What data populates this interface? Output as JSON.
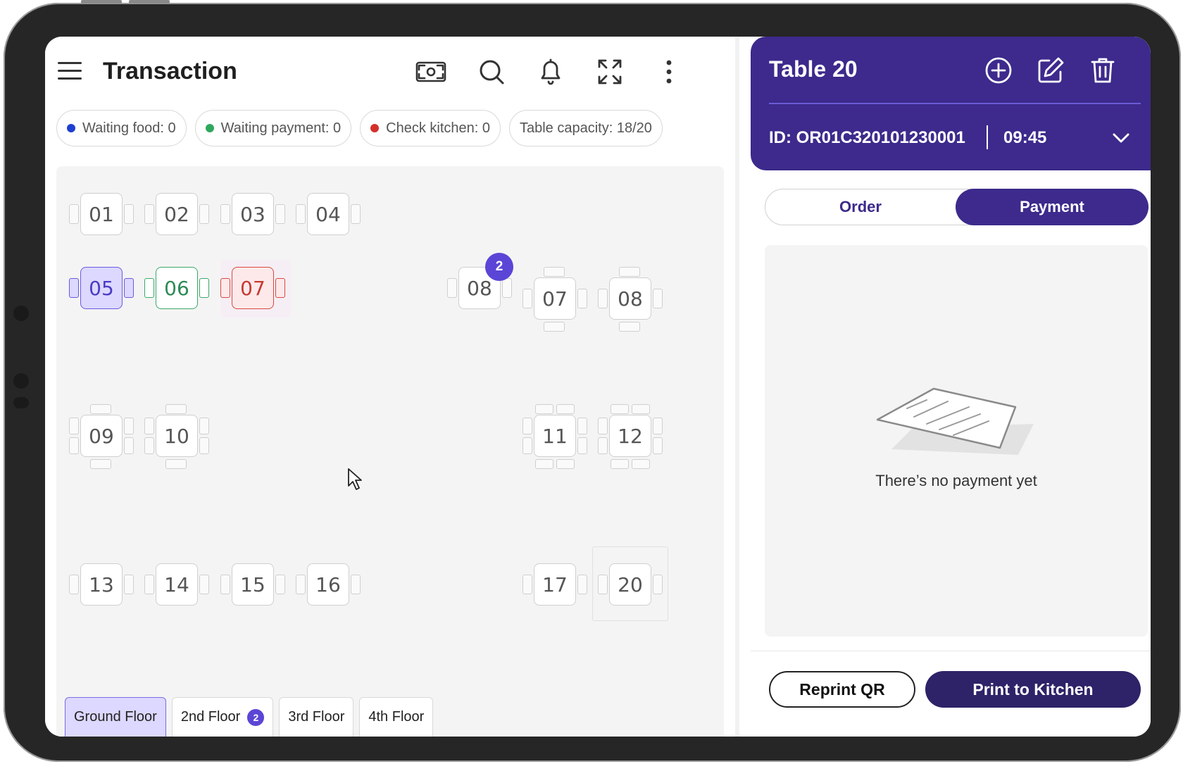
{
  "header": {
    "title": "Transaction"
  },
  "status_chips": [
    {
      "label": "Waiting food: 0",
      "color": "#1f3fd0"
    },
    {
      "label": "Waiting payment: 0",
      "color": "#2fa85e"
    },
    {
      "label": "Check kitchen: 0",
      "color": "#d3302b"
    },
    {
      "label": "Table capacity: 18/20"
    }
  ],
  "tables": [
    {
      "label": "01",
      "status": "empty"
    },
    {
      "label": "02",
      "status": "empty"
    },
    {
      "label": "03",
      "status": "empty"
    },
    {
      "label": "04",
      "status": "empty"
    },
    {
      "label": "05",
      "status": "waiting-food"
    },
    {
      "label": "06",
      "status": "waiting-payment"
    },
    {
      "label": "07",
      "status": "check-kitchen"
    },
    {
      "label": "08",
      "status": "empty",
      "badge": "2"
    },
    {
      "label": "07",
      "status": "empty"
    },
    {
      "label": "08",
      "status": "empty"
    },
    {
      "label": "09",
      "status": "empty"
    },
    {
      "label": "10",
      "status": "empty"
    },
    {
      "label": "11",
      "status": "empty"
    },
    {
      "label": "12",
      "status": "empty"
    },
    {
      "label": "13",
      "status": "empty"
    },
    {
      "label": "14",
      "status": "empty"
    },
    {
      "label": "15",
      "status": "empty"
    },
    {
      "label": "16",
      "status": "empty"
    },
    {
      "label": "17",
      "status": "empty"
    },
    {
      "label": "20",
      "status": "selected"
    }
  ],
  "floor_tabs": [
    {
      "label": "Ground Floor",
      "active": true
    },
    {
      "label": "2nd Floor",
      "badge": "2"
    },
    {
      "label": "3rd Floor"
    },
    {
      "label": "4th Floor"
    }
  ],
  "detail": {
    "title": "Table 20",
    "order_id": "ID: OR01C320101230001",
    "time": "09:45",
    "tabs": {
      "order": "Order",
      "payment": "Payment",
      "active": "Payment"
    },
    "empty_message": "There’s no payment yet",
    "reprint_label": "Reprint QR",
    "print_label": "Print to Kitchen"
  },
  "colors": {
    "brand": "#3d2a8c",
    "brand_dark": "#2e2268",
    "badge": "#5b45d6"
  },
  "icons": {
    "topbar": [
      "menu-icon",
      "cash-icon",
      "search-icon",
      "bell-icon",
      "expand-icon",
      "more-vertical-icon"
    ],
    "detail": [
      "add-circle-icon",
      "edit-icon",
      "trash-icon",
      "chevron-down-icon"
    ]
  }
}
